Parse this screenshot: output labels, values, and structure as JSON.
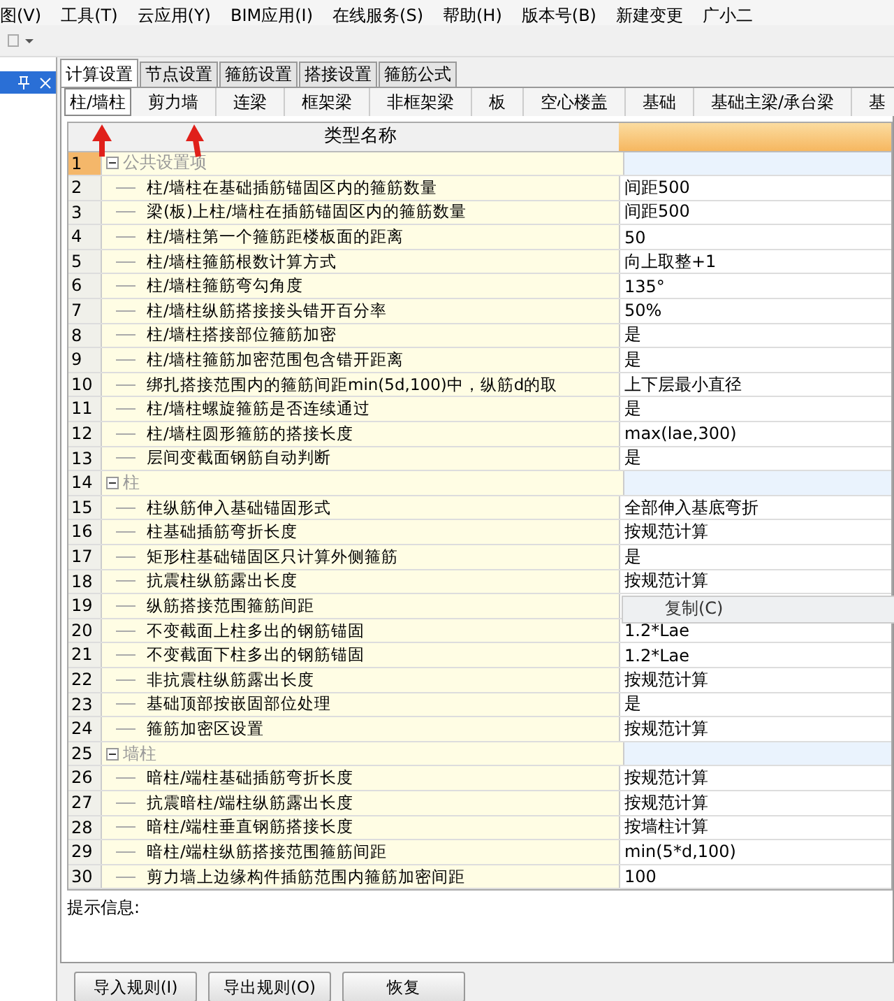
{
  "menu": [
    "图(V)",
    "工具(T)",
    "云应用(Y)",
    "BIM应用(I)",
    "在线服务(S)",
    "帮助(H)",
    "版本号(B)",
    "新建变更",
    "广小二"
  ],
  "main_tabs": [
    {
      "label": "计算设置",
      "selected": true
    },
    {
      "label": "节点设置",
      "selected": false
    },
    {
      "label": "箍筋设置",
      "selected": false
    },
    {
      "label": "搭接设置",
      "selected": false
    },
    {
      "label": "箍筋公式",
      "selected": false
    }
  ],
  "sub_tabs": [
    {
      "label": "柱/墙柱",
      "selected": true
    },
    {
      "label": "剪力墙",
      "selected": false
    },
    {
      "label": "连梁",
      "selected": false
    },
    {
      "label": "框架梁",
      "selected": false
    },
    {
      "label": "非框架梁",
      "selected": false
    },
    {
      "label": "板",
      "selected": false
    },
    {
      "label": "空心楼盖",
      "selected": false
    },
    {
      "label": "基础",
      "selected": false
    },
    {
      "label": "基础主梁/承台梁",
      "selected": false
    },
    {
      "label": "基",
      "selected": false
    }
  ],
  "table": {
    "columns": [
      "类型名称"
    ],
    "rows": [
      {
        "no": "1",
        "label": "公共设置项",
        "expanded": true,
        "selected": true,
        "children": [
          {
            "no": "2",
            "name": "柱/墙柱在基础插筋锚固区内的箍筋数量",
            "value": "间距500",
            "selected": false
          },
          {
            "no": "3",
            "name": "梁(板)上柱/墙柱在插筋锚固区内的箍筋数量",
            "value": "间距500",
            "selected": false
          },
          {
            "no": "4",
            "name": "柱/墙柱第一个箍筋距楼板面的距离",
            "value": "50",
            "selected": false
          },
          {
            "no": "5",
            "name": "柱/墙柱箍筋根数计算方式",
            "value": "向上取整+1",
            "selected": false
          },
          {
            "no": "6",
            "name": "柱/墙柱箍筋弯勾角度",
            "value": "135°",
            "selected": false
          },
          {
            "no": "7",
            "name": "柱/墙柱纵筋搭接接头错开百分率",
            "value": "50%",
            "selected": false
          },
          {
            "no": "8",
            "name": "柱/墙柱搭接部位箍筋加密",
            "value": "是",
            "selected": false
          },
          {
            "no": "9",
            "name": "柱/墙柱箍筋加密范围包含错开距离",
            "value": "是",
            "selected": false
          },
          {
            "no": "10",
            "name": "绑扎搭接范围内的箍筋间距min(5d,100)中，纵筋d的取",
            "value": "上下层最小直径",
            "selected": false
          },
          {
            "no": "11",
            "name": "柱/墙柱螺旋箍筋是否连续通过",
            "value": "是",
            "selected": false
          },
          {
            "no": "12",
            "name": "柱/墙柱圆形箍筋的搭接长度",
            "value": "max(lae,300)",
            "selected": false
          },
          {
            "no": "13",
            "name": "层间变截面钢筋自动判断",
            "value": "是",
            "selected": false
          }
        ]
      },
      {
        "no": "14",
        "label": "柱",
        "expanded": true,
        "selected": false,
        "children": [
          {
            "no": "15",
            "name": "柱纵筋伸入基础锚固形式",
            "value": "全部伸入基底弯折",
            "selected": false
          },
          {
            "no": "16",
            "name": "柱基础插筋弯折长度",
            "value": "按规范计算",
            "selected": false
          },
          {
            "no": "17",
            "name": "矩形柱基础锚固区只计算外侧箍筋",
            "value": "是",
            "selected": false
          },
          {
            "no": "18",
            "name": "抗震柱纵筋露出长度",
            "value": "按规范计算",
            "selected": false
          },
          {
            "no": "19",
            "name": "纵筋搭接范围箍筋间距",
            "selected": false
          },
          {
            "no": "20",
            "name": "不变截面上柱多出的钢筋锚固",
            "value": "1.2*Lae",
            "selected": false
          },
          {
            "no": "21",
            "name": "不变截面下柱多出的钢筋锚固",
            "value": "1.2*Lae",
            "selected": false
          },
          {
            "no": "22",
            "name": "非抗震柱纵筋露出长度",
            "value": "按规范计算",
            "selected": false
          },
          {
            "no": "23",
            "name": "基础顶部按嵌固部位处理",
            "value": "是",
            "selected": false
          },
          {
            "no": "24",
            "name": "箍筋加密区设置",
            "value": "按规范计算",
            "selected": false
          }
        ]
      },
      {
        "no": "25",
        "label": "墙柱",
        "expanded": true,
        "selected": false,
        "children": [
          {
            "no": "26",
            "name": "暗柱/端柱基础插筋弯折长度",
            "value": "按规范计算",
            "selected": false
          },
          {
            "no": "27",
            "name": "抗震暗柱/端柱纵筋露出长度",
            "value": "按规范计算",
            "selected": false
          },
          {
            "no": "28",
            "name": "暗柱/端柱垂直钢筋搭接长度",
            "value": "按墙柱计算",
            "selected": false
          },
          {
            "no": "29",
            "name": "暗柱/端柱纵筋搭接范围箍筋间距",
            "value": "min(5*d,100)",
            "selected": false
          },
          {
            "no": "30",
            "name": "剪力墙上边缘构件插筋范围内箍筋加密间距",
            "value": "100",
            "selected": false
          }
        ]
      }
    ]
  },
  "context_menu": {
    "items": [
      "复制(C)"
    ]
  },
  "hint_label": "提示信息:",
  "buttons": [
    "导入规则(I)",
    "导出规则(O)",
    "恢复"
  ]
}
